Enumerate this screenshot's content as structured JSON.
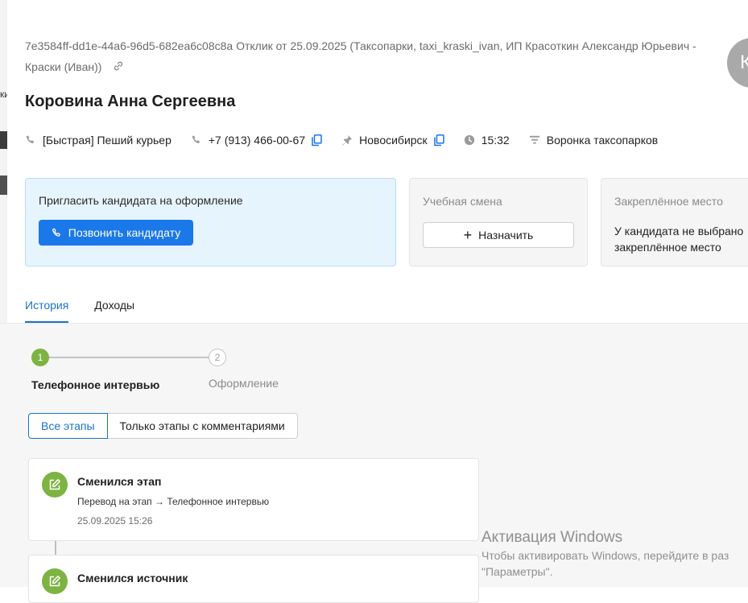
{
  "header": {
    "uuid_line": "7e3584ff-dd1e-44a6-96d5-682ea6c08c8a Отклик от 25.09.2025 (Таксопарки, taxi_kraski_ivan, ИП Красоткин Александр Юрьевич - Краски (Иван))",
    "avatar_letter": "К"
  },
  "candidate": {
    "name": "Коровина Анна Сергеевна",
    "vacancy": "[Быстрая] Пеший курьер",
    "phone": "+7 (913) 466-00-67",
    "city": "Новосибирск",
    "time": "15:32",
    "funnel": "Воронка таксопарков"
  },
  "cards": {
    "invite": {
      "title": "Пригласить кандидата на оформление",
      "button": "Позвонить кандидату"
    },
    "training_shift": {
      "title": "Учебная смена",
      "button": "Назначить"
    },
    "fixed_place": {
      "title": "Закреплённое место",
      "text": "У кандидата не выбрано закреплённое место"
    }
  },
  "tabs": [
    {
      "label": "История",
      "active": true
    },
    {
      "label": "Доходы",
      "active": false
    }
  ],
  "stepper": {
    "steps": [
      {
        "number": "1",
        "label": "Телефонное интервью",
        "state": "active"
      },
      {
        "number": "2",
        "label": "Оформление",
        "state": "pending"
      }
    ]
  },
  "filters": {
    "all": "Все этапы",
    "commented": "Только этапы с комментариями",
    "selected": "all"
  },
  "events": [
    {
      "title": "Сменился этап",
      "description": "Перевод на этап → Телефонное интервью",
      "date": "25.09.2025 15:26"
    },
    {
      "title": "Сменился источник"
    }
  ],
  "watermark": {
    "title": "Активация Windows",
    "line1": "Чтобы активировать Windows, перейдите в раз",
    "line2": "\"Параметры\"."
  },
  "edge_chars": [
    "ки",
    "И",
    "Д"
  ],
  "colors": {
    "accent": "#1a73c8",
    "primary_button": "#1a78e8",
    "step_active": "#7cb342",
    "invite_bg": "#e6f4fd"
  }
}
